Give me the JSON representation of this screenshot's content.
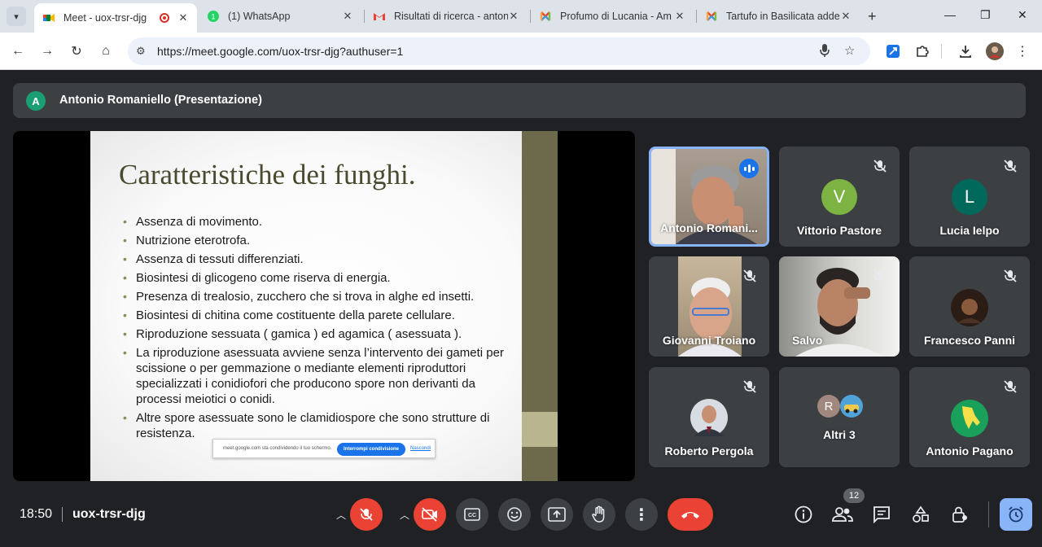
{
  "browser": {
    "tabs": [
      {
        "title": "Meet - uox-trsr-djg",
        "icon": "meet-icon",
        "active": true,
        "recording": true
      },
      {
        "title": "(1) WhatsApp",
        "icon": "whatsapp-icon"
      },
      {
        "title": "Risultati di ricerca - anton",
        "icon": "gmail-icon"
      },
      {
        "title": "Profumo di Lucania - Am",
        "icon": "joomla-icon"
      },
      {
        "title": "Tartufo in Basilicata adde",
        "icon": "joomla-icon"
      }
    ],
    "url": "https://meet.google.com/uox-trsr-djg?authuser=1",
    "new_tab": "+"
  },
  "meet": {
    "presenter": {
      "initial": "A",
      "name": "Antonio Romaniello (Presentazione)"
    },
    "slide": {
      "title": "Caratteristiche dei funghi.",
      "bullets": [
        "Assenza di movimento.",
        "Nutrizione eterotrofa.",
        "Assenza di tessuti differenziati.",
        "Biosintesi di glicogeno come riserva di energia.",
        "Presenza di trealosio, zucchero che si  trova in alghe ed insetti.",
        "Biosintesi di chitina come costituente della parete cellulare.",
        "Riproduzione sessuata ( gamica ) ed agamica ( asessuata ).",
        "La riproduzione asessuata avviene senza l’intervento dei gameti per scissione o per gemmazione o mediante elementi riproduttori specializzati i conidiofori che producono spore non derivanti da processi meiotici o conidi.",
        "Altre spore asessuate sono le clamidiospore che sono strutture di resistenza."
      ],
      "share_bar": {
        "message": "meet.google.com sta condividendo il tuo schermo.",
        "stop_label": "Interrompi condivisione",
        "hide_label": "Nascondi"
      }
    },
    "participants": [
      {
        "name": "Antonio Romani...",
        "speaking": true
      },
      {
        "name": "Vittorio Pastore",
        "initial": "V",
        "color": "#7cb342"
      },
      {
        "name": "Lucia Ielpo",
        "initial": "L",
        "color": "#00695c"
      },
      {
        "name": "Giovanni Troiano"
      },
      {
        "name": "Salvo"
      },
      {
        "name": "Francesco Panni"
      },
      {
        "name": "Roberto Pergola"
      },
      {
        "name": "Altri 3",
        "initial": "R"
      },
      {
        "name": "Antonio Pagano"
      }
    ],
    "bottom": {
      "time": "18:50",
      "meeting_code": "uox-trsr-djg",
      "participant_count": "12"
    }
  },
  "colors": {
    "meet_bg": "#202124",
    "tile_bg": "#3c4043",
    "danger": "#ea4335",
    "accent": "#8ab4f8"
  }
}
